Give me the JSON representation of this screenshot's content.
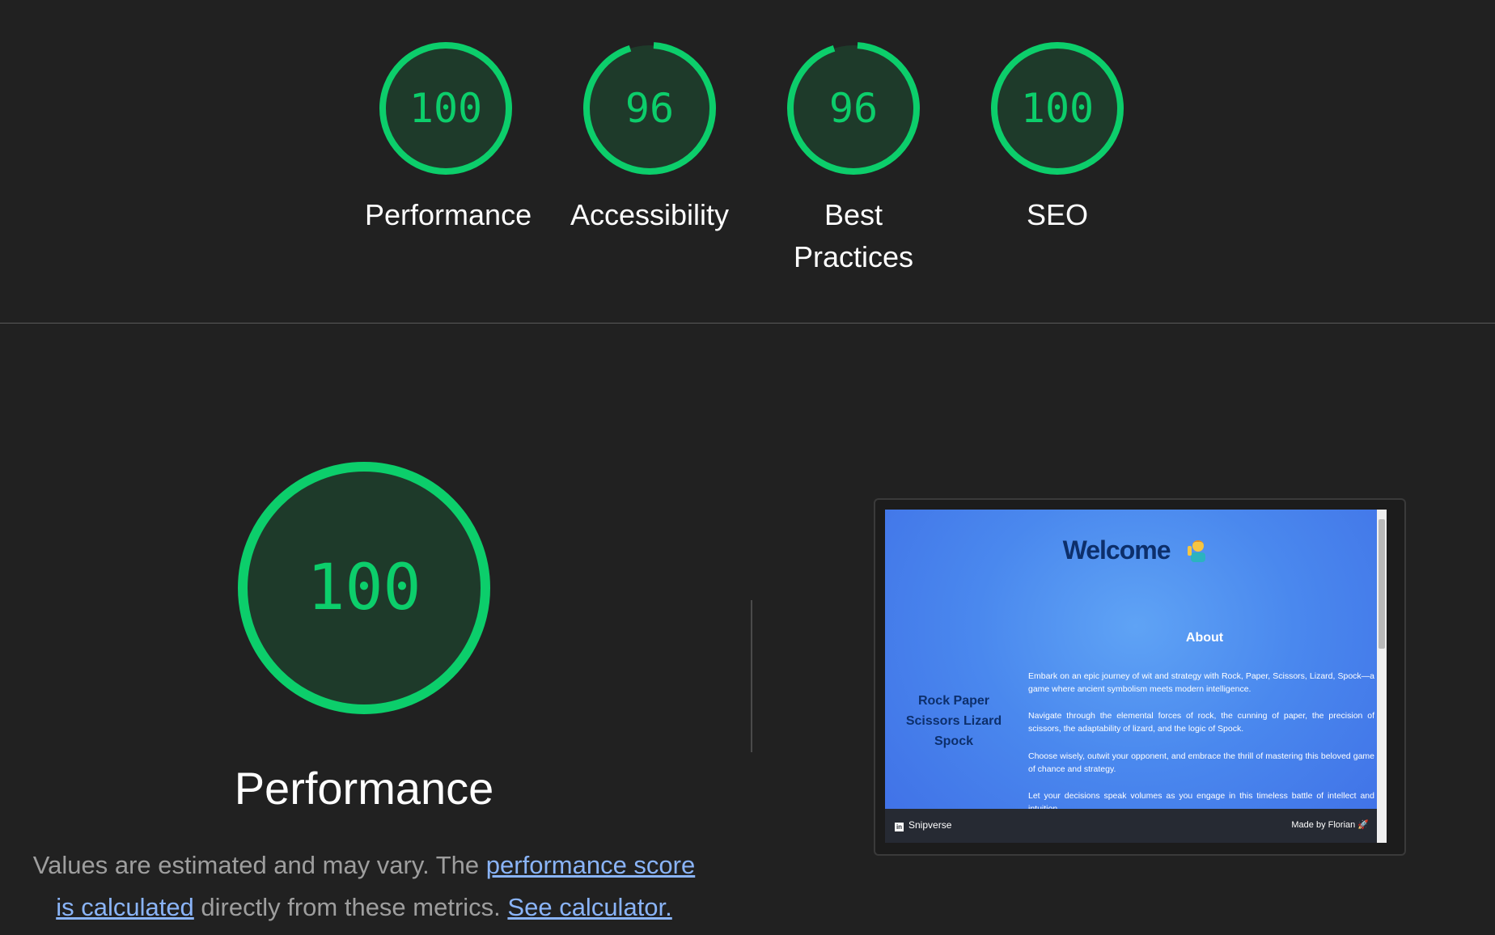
{
  "gauges": [
    {
      "score": 100,
      "label": "Performance"
    },
    {
      "score": 96,
      "label": "Accessibility"
    },
    {
      "score": 96,
      "label": "Best Practices"
    },
    {
      "score": 100,
      "label": "SEO"
    }
  ],
  "performance": {
    "score": 100,
    "title": "Performance",
    "desc_prefix": "Values are estimated and may vary. The",
    "desc_link1": "performance score is calculated",
    "desc_middle": "directly from these metrics.",
    "desc_link2": "See calculator."
  },
  "screenshot": {
    "welcome": "Welcome",
    "about_heading": "About",
    "side_title": "Rock Paper Scissors Lizard Spock",
    "paragraphs": [
      "Embark on an epic journey of wit and strategy with Rock, Paper, Scissors, Lizard, Spock—a game where ancient symbolism meets modern intelligence.",
      "Navigate through the elemental forces of rock, the cunning of paper, the precision of scissors, the adaptability of lizard, and the logic of Spock.",
      "Choose wisely, outwit your opponent, and embrace the thrill of mastering this beloved game of chance and strategy.",
      "Let your decisions speak volumes as you engage in this timeless battle of intellect and intuition."
    ],
    "footer_left": "Snipverse",
    "footer_right": "Made by Florian 🚀"
  },
  "colors": {
    "pass": "#0cce6b",
    "gauge_fill": "#1e3a2a",
    "background": "#212121",
    "link": "#8ab4f8"
  }
}
